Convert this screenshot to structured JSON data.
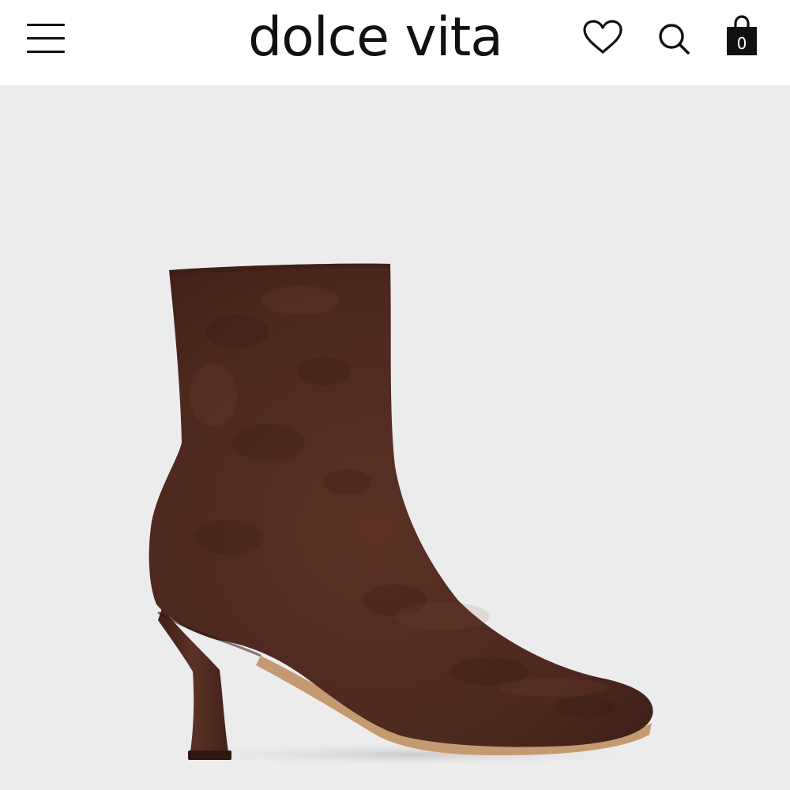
{
  "header": {
    "brand": "dolce vita",
    "menu_icon": "hamburger-menu-icon",
    "wishlist_icon": "heart-icon",
    "search_icon": "search-icon",
    "bag_icon": "shopping-bag-icon",
    "bag_count": "0"
  },
  "product": {
    "image": "brown-suede-ankle-boot",
    "colors": {
      "suede": "#4f2a20",
      "background": "#ececec",
      "sole": "#c49a72"
    }
  }
}
